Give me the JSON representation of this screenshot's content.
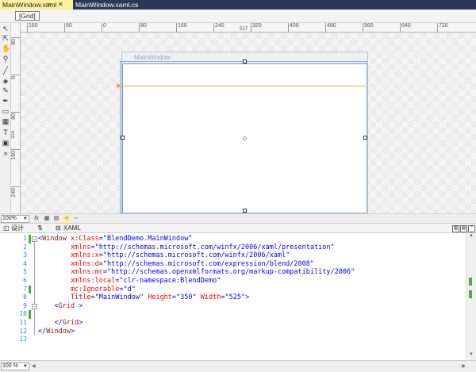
{
  "tabs": [
    {
      "label": "MainWindow.xaml",
      "active": true,
      "pin_icon": "pin-icon",
      "close_icon": "close-icon"
    },
    {
      "label": "MainWindow.xaml.cs",
      "active": false
    }
  ],
  "breadcrumb": {
    "item": "[Grid]"
  },
  "ruler": {
    "h_ticks": [
      "160",
      "80",
      "0",
      "80",
      "160",
      "240",
      "320",
      "400",
      "480",
      "560",
      "640",
      "720"
    ],
    "h_center": "517",
    "v_ticks": [
      "80",
      "0",
      "80",
      "160",
      "240"
    ],
    "v_center": "319"
  },
  "artboard": {
    "window_title": "MainWindow"
  },
  "design_bar": {
    "zoom": "100%",
    "fx_label": "fx"
  },
  "split_tabs": {
    "design": "设计",
    "swap": "⇅",
    "xaml": "XAML"
  },
  "editor": {
    "line_numbers": [
      "1",
      "2",
      "3",
      "4",
      "5",
      "6",
      "7",
      "8",
      "9",
      "10",
      "11",
      "12",
      "13"
    ],
    "changed_lines": [
      1,
      7,
      10
    ],
    "lines": [
      [
        {
          "c": "p",
          "s": "<"
        },
        {
          "c": "t",
          "s": "Window"
        },
        {
          "c": "a",
          "s": " x:Class"
        },
        {
          "c": "p",
          "s": "=\""
        },
        {
          "c": "v",
          "s": "BlendDemo.MainWindow"
        },
        {
          "c": "p",
          "s": "\""
        }
      ],
      [
        {
          "c": "a",
          "s": "        xmlns"
        },
        {
          "c": "p",
          "s": "=\""
        },
        {
          "c": "v",
          "s": "http://schemas.microsoft.com/winfx/2006/xaml/presentation"
        },
        {
          "c": "p",
          "s": "\""
        }
      ],
      [
        {
          "c": "a",
          "s": "        xmlns:x"
        },
        {
          "c": "p",
          "s": "=\""
        },
        {
          "c": "v",
          "s": "http://schemas.microsoft.com/winfx/2006/xaml"
        },
        {
          "c": "p",
          "s": "\""
        }
      ],
      [
        {
          "c": "a",
          "s": "        xmlns:d"
        },
        {
          "c": "p",
          "s": "=\""
        },
        {
          "c": "v",
          "s": "http://schemas.microsoft.com/expression/blend/2008"
        },
        {
          "c": "p",
          "s": "\""
        }
      ],
      [
        {
          "c": "a",
          "s": "        xmlns:mc"
        },
        {
          "c": "p",
          "s": "=\""
        },
        {
          "c": "v",
          "s": "http://schemas.openxmlformats.org/markup-compatibility/2006"
        },
        {
          "c": "p",
          "s": "\""
        }
      ],
      [
        {
          "c": "a",
          "s": "        xmlns:local"
        },
        {
          "c": "p",
          "s": "=\""
        },
        {
          "c": "v",
          "s": "clr-namespace:BlendDemo"
        },
        {
          "c": "p",
          "s": "\""
        }
      ],
      [
        {
          "c": "a",
          "s": "        mc:Ignorable"
        },
        {
          "c": "p",
          "s": "=\""
        },
        {
          "c": "v",
          "s": "d"
        },
        {
          "c": "p",
          "s": "\""
        }
      ],
      [
        {
          "c": "a",
          "s": "        Title"
        },
        {
          "c": "p",
          "s": "=\""
        },
        {
          "c": "v",
          "s": "MainWindow"
        },
        {
          "c": "p",
          "s": "\""
        },
        {
          "c": "a",
          "s": " Height"
        },
        {
          "c": "p",
          "s": "=\""
        },
        {
          "c": "v",
          "s": "350"
        },
        {
          "c": "p",
          "s": "\""
        },
        {
          "c": "a",
          "s": " Width"
        },
        {
          "c": "p",
          "s": "=\""
        },
        {
          "c": "v",
          "s": "525"
        },
        {
          "c": "p",
          "s": "\">"
        }
      ],
      [
        {
          "c": "p",
          "s": "    <"
        },
        {
          "c": "t",
          "s": "Grid"
        },
        {
          "c": "p",
          "s": " >"
        }
      ],
      [
        {
          "c": "p",
          "s": ""
        }
      ],
      [
        {
          "c": "p",
          "s": "    </"
        },
        {
          "c": "t",
          "s": "Grid"
        },
        {
          "c": "p",
          "s": ">"
        }
      ],
      [
        {
          "c": "p",
          "s": "</"
        },
        {
          "c": "t",
          "s": "Window"
        },
        {
          "c": "p",
          "s": ">"
        }
      ],
      [
        {
          "c": "p",
          "s": ""
        }
      ]
    ]
  },
  "status": {
    "zoom": "100 %"
  },
  "colors": {
    "tabstrip": "#293955",
    "active_tab": "#fff29d",
    "grid_divider": "#f3a33a",
    "selection": "#6f95cf",
    "change_marker": "#57a64a"
  }
}
